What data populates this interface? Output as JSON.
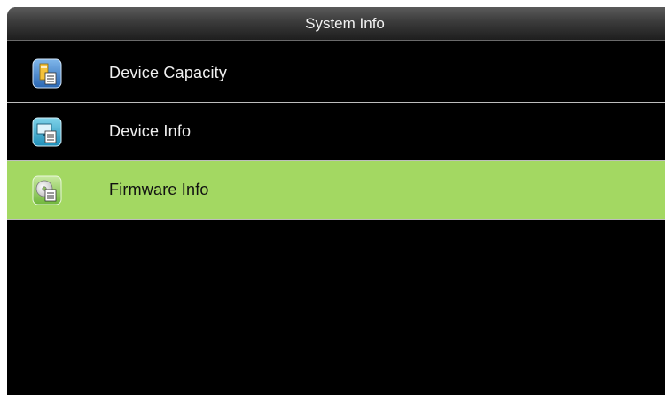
{
  "window": {
    "title": "System Info"
  },
  "menu": {
    "items": [
      {
        "label": "Device Capacity",
        "icon": "device-capacity-icon",
        "selected": false
      },
      {
        "label": "Device Info",
        "icon": "device-info-icon",
        "selected": false
      },
      {
        "label": "Firmware Info",
        "icon": "firmware-info-icon",
        "selected": true
      }
    ]
  },
  "colors": {
    "background": "#000000",
    "selected_row": "#a3d862",
    "title_bar": "#3b3b3b",
    "separator": "#bdbdbd"
  }
}
